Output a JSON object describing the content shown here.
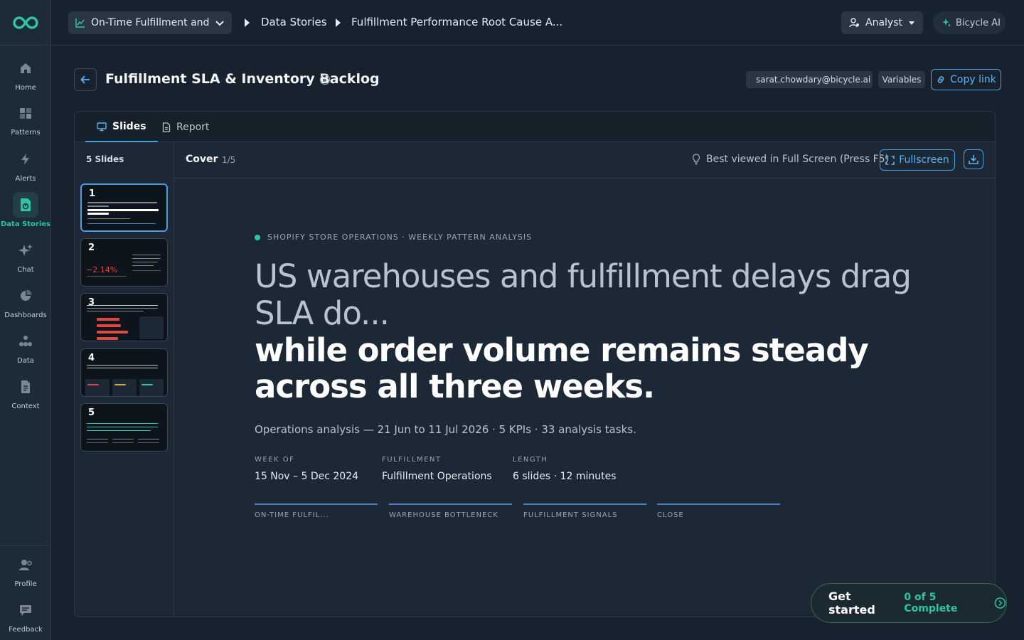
{
  "topbar": {
    "story_select": "On-Time Fulfillment and ...",
    "crumbs": [
      "Data Stories",
      "Fulfillment Performance Root Cause A..."
    ],
    "role": "Analyst",
    "ai_label": "Bicycle AI"
  },
  "sidebar": {
    "items": [
      {
        "label": "Home",
        "icon": "home-icon"
      },
      {
        "label": "Patterns",
        "icon": "patterns-icon"
      },
      {
        "label": "Alerts",
        "icon": "bolt-icon"
      },
      {
        "label": "Data Stories",
        "icon": "data-stories-icon",
        "active": true
      },
      {
        "label": "Chat",
        "icon": "sparkle-icon"
      },
      {
        "label": "Dashboards",
        "icon": "pie-icon"
      },
      {
        "label": "Data",
        "icon": "data-icon"
      },
      {
        "label": "Context",
        "icon": "document-icon"
      }
    ],
    "bottom": [
      {
        "label": "Profile",
        "icon": "profile-icon"
      },
      {
        "label": "Feedback",
        "icon": "feedback-icon"
      }
    ]
  },
  "header": {
    "title": "Fulfillment SLA & Inventory Backlog",
    "owner": "sarat.chowdary@bicycle.ai",
    "variables": "Variables",
    "copy_link": "Copy link"
  },
  "tabs": [
    {
      "label": "Slides",
      "active": true
    },
    {
      "label": "Report",
      "active": false
    }
  ],
  "slides": {
    "count_label": "5 Slides",
    "thumbs": [
      {
        "num": "1",
        "active": true
      },
      {
        "num": "2",
        "kpi": "−2.14%"
      },
      {
        "num": "3"
      },
      {
        "num": "4"
      },
      {
        "num": "5"
      }
    ]
  },
  "viewer": {
    "slide_title": "Cover",
    "slide_position": "1/5",
    "best_viewed": "Best viewed in Full Screen (Press F5)",
    "fullscreen": "Fullscreen"
  },
  "cover": {
    "kicker": "SHOPIFY STORE OPERATIONS · WEEKLY PATTERN ANALYSIS",
    "headline_light": "US warehouses and fulfillment delays drag SLA do...",
    "headline_bold": "while order volume remains steady across all three weeks.",
    "subtitle": "Operations analysis — 21 Jun to 11 Jul 2026 · 5 KPIs · 33 analysis tasks.",
    "meta": [
      {
        "label": "WEEK OF",
        "value": "15 Nov – 5 Dec 2024"
      },
      {
        "label": "FULFILLMENT",
        "value": "Fulfillment Operations"
      },
      {
        "label": "LENGTH",
        "value": "6 slides · 12 minutes"
      }
    ],
    "steps": [
      "ON-TIME FULFIL...",
      "WAREHOUSE BOTTLENECK",
      "FULFILLMENT SIGNALS",
      "CLOSE"
    ]
  },
  "get_started": {
    "title": "Get started",
    "progress": "0 of 5 Complete"
  },
  "colors": {
    "accent_teal": "#2ec4a6",
    "accent_blue": "#4a9fe0",
    "negative_red": "#e0483e"
  }
}
